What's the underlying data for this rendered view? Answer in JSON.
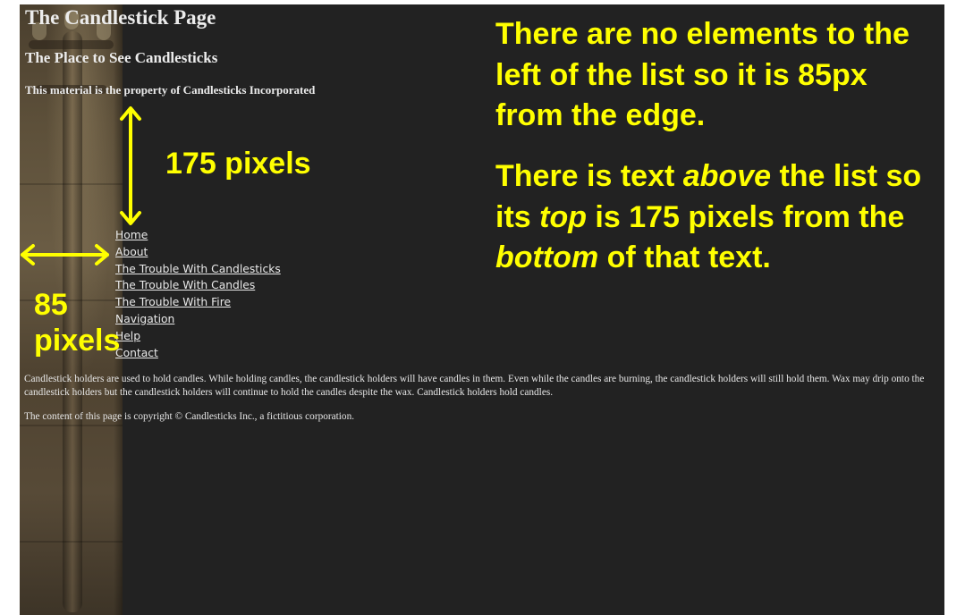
{
  "site": {
    "title": "The Candlestick Page",
    "subtitle": "The Place to See Candlesticks",
    "ownership": "This material is the property of Candlesticks Incorporated"
  },
  "nav": {
    "items": [
      {
        "label": "Home"
      },
      {
        "label": "About"
      },
      {
        "label": "The Trouble With Candlesticks"
      },
      {
        "label": "The Trouble With Candles"
      },
      {
        "label": "The Trouble With Fire"
      },
      {
        "label": "Navigation"
      },
      {
        "label": "Help"
      },
      {
        "label": "Contact"
      }
    ]
  },
  "content": {
    "paragraph": "Candlestick holders are used to hold candles. While holding candles, the candlestick holders will have candles in them. Even while the candles are burning, the candlestick holders will still hold them. Wax may drip onto the candlestick holders but the candlestick holders will continue to hold the candles despite the wax. Candlestick holders hold candles.",
    "copyright": "The content of this page is copyright © Candlesticks Inc., a fictitious corporation."
  },
  "annotations": {
    "color": "#ffff00",
    "vertical_label": "175 pixels",
    "horizontal_label_line1": "85",
    "horizontal_label_line2": "pixels",
    "note1": {
      "before": "There are no elements to the left of the list so it is 85px from the edge."
    },
    "note2": {
      "t1": "There is text ",
      "e1": "above",
      "t2": " the list so its ",
      "e2": "top",
      "t3": " is 175 pixels from the ",
      "e3": "bottom",
      "t4": " of that text."
    }
  },
  "colors": {
    "page_background": "#222222",
    "text": "#ececec",
    "annotation": "#ffff00"
  }
}
